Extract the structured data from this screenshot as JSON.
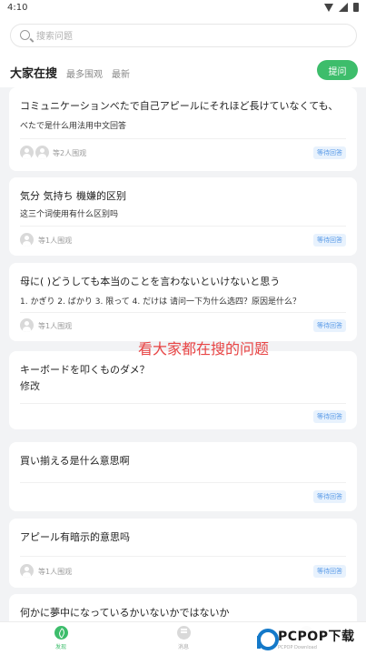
{
  "status": {
    "time": "4:10"
  },
  "search": {
    "placeholder": "搜索问题"
  },
  "tabs": [
    {
      "label": "大家在搜",
      "active": true
    },
    {
      "label": "最多围观",
      "active": false
    },
    {
      "label": "最新",
      "active": false
    }
  ],
  "ask_button": "提问",
  "questions": [
    {
      "title": "コミュニケーションべたで自己アピールにそれほど長けていなくても、",
      "subtitle": "べたで是什么用法用中文回答",
      "watchers": "等2人围观",
      "status": "等待回答"
    },
    {
      "title": "気分 気持ち 機嫌的区别",
      "subtitle": "这三个词使用有什么区别吗",
      "watchers": "等1人围观",
      "status": "等待回答"
    },
    {
      "title": "母に( )どうしても本当のことを言わないといけないと思う",
      "subtitle": "1. かぎり  2. ばかり  3. 限って  4. だけは  请问一下为什么选四？原因是什么？",
      "watchers": "等1人围观",
      "status": "等待回答"
    },
    {
      "title": "キーボードを叩くものダメ？",
      "subtitle": "修改",
      "watchers": "",
      "status": "等待回答"
    },
    {
      "title": "買い揃える是什么意思啊",
      "subtitle": "",
      "watchers": "",
      "status": "等待回答"
    },
    {
      "title": "アピール有暗示的意思吗",
      "subtitle": "",
      "watchers": "等1人围观",
      "status": "等待回答"
    },
    {
      "title": "何かに夢中になっているかいないかではないか",
      "subtitle": "",
      "watchers": "",
      "status": ""
    }
  ],
  "overlay_caption": "看大家都在搜的问题",
  "bottom_nav": [
    {
      "label": "发现",
      "active": true
    },
    {
      "label": "消息",
      "active": false
    },
    {
      "label": "",
      "active": false
    }
  ],
  "watermark": {
    "text": "PCPOP下载",
    "sub": "PCPOP Download"
  },
  "colors": {
    "accent": "#3dbd6b",
    "badge_text": "#5a9be8",
    "badge_bg": "#e8f2fd",
    "overlay": "#e84545",
    "watermark_blue": "#1479c9"
  }
}
